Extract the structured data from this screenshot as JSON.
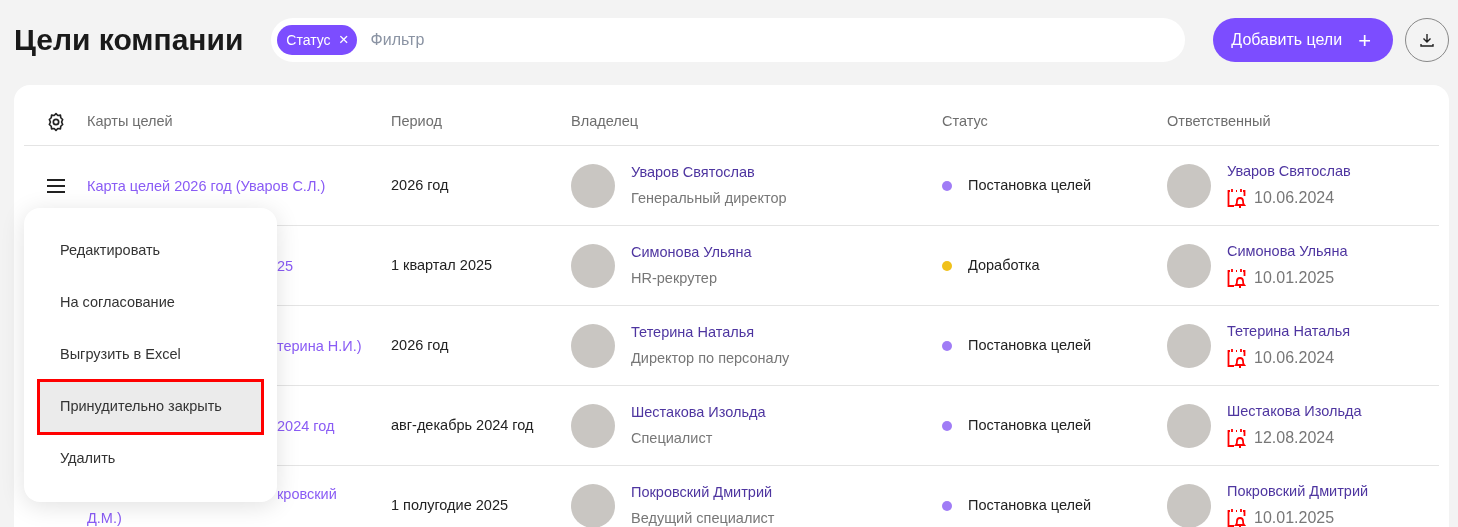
{
  "page": {
    "title": "Цели компании"
  },
  "filter": {
    "chips": [
      {
        "label": "Статус",
        "remove": "×"
      }
    ],
    "placeholder": "Фильтр"
  },
  "actions": {
    "add_button": "Добавить цели",
    "add_symbol": "+"
  },
  "table": {
    "columns": [
      "Карты целей",
      "Период",
      "Владелец",
      "Статус",
      "Ответственный"
    ],
    "rows": [
      {
        "menu_icon": true,
        "map_name": [
          {
            "text": "Карта целей 2026 год (Уваров С.Л.)",
            "behind_menu": false
          }
        ],
        "period": "2026 год",
        "owner": {
          "name": "Уваров Святослав",
          "position": "Генеральный директор"
        },
        "status": {
          "label": "Постановка целей",
          "color": "#a07cf6"
        },
        "responsible": {
          "name": "Уваров Святослав",
          "date": "10.06.2024"
        }
      },
      {
        "menu_icon": false,
        "map_name": [
          {
            "text": "25",
            "behind_menu": true
          }
        ],
        "period": "1 квартал 2025",
        "owner": {
          "name": "Симонова Ульяна",
          "position": "HR-рекрутер"
        },
        "status": {
          "label": "Доработка",
          "color": "#f0c11b"
        },
        "responsible": {
          "name": "Симонова Ульяна",
          "date": "10.01.2025"
        }
      },
      {
        "menu_icon": false,
        "map_name": [
          {
            "text": "терина Н.И.)",
            "behind_menu": true
          }
        ],
        "period": "2026 год",
        "owner": {
          "name": "Тетерина Наталья",
          "position": "Директор по персоналу"
        },
        "status": {
          "label": "Постановка целей",
          "color": "#a07cf6"
        },
        "responsible": {
          "name": "Тетерина Наталья",
          "date": "10.06.2024"
        }
      },
      {
        "menu_icon": false,
        "map_name": [
          {
            "text": "2024 год",
            "behind_menu": true
          }
        ],
        "period": "авг-декабрь 2024 год",
        "owner": {
          "name": "Шестакова Изольда",
          "position": "Специалист"
        },
        "status": {
          "label": "Постановка целей",
          "color": "#a07cf6"
        },
        "responsible": {
          "name": "Шестакова Изольда",
          "date": "12.08.2024"
        }
      },
      {
        "menu_icon": false,
        "map_name": [
          {
            "text": "кровский",
            "behind_menu": true
          },
          {
            "text": "Д.М.)",
            "behind_menu": false
          }
        ],
        "period": "1 полугодие 2025",
        "owner": {
          "name": "Покровский Дмитрий",
          "position": "Ведущий специалист"
        },
        "status": {
          "label": "Постановка целей",
          "color": "#a07cf6"
        },
        "responsible": {
          "name": "Покровский Дмитрий",
          "date": "10.01.2025"
        }
      }
    ]
  },
  "context_menu": {
    "items": [
      {
        "label": "Редактировать",
        "highlighted": false
      },
      {
        "label": "На согласование",
        "highlighted": false
      },
      {
        "label": "Выгрузить в Excel",
        "highlighted": false
      },
      {
        "label": "Принудительно закрыть",
        "highlighted": true
      },
      {
        "label": "Удалить",
        "highlighted": false
      }
    ]
  }
}
